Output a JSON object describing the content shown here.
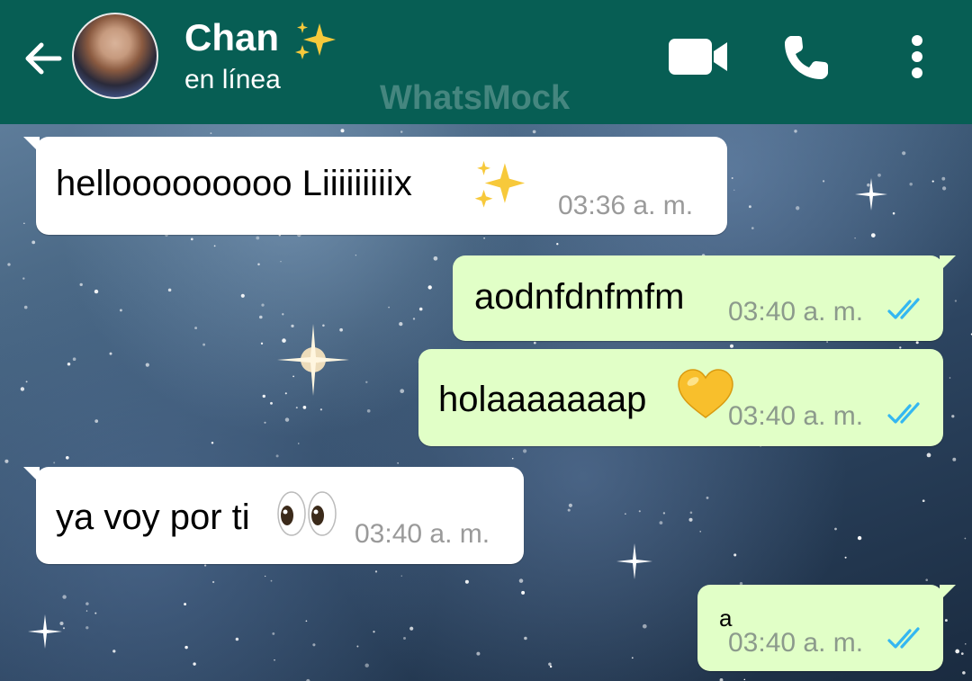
{
  "header": {
    "contact_name": "Chan",
    "status": "en línea",
    "watermark": "WhatsMock",
    "icons": [
      "back-arrow-icon",
      "sparkles-icon",
      "video-call-icon",
      "phone-icon",
      "more-vert-icon"
    ]
  },
  "messages": [
    {
      "direction": "in",
      "text": "hellooooooooo Liiiiiiiiix",
      "emoji": "sparkles",
      "time": "03:36 a. m."
    },
    {
      "direction": "out",
      "text": "aodnfdnfmfm",
      "time": "03:40 a. m.",
      "status": "read"
    },
    {
      "direction": "out",
      "text": "holaaaaaaap",
      "emoji": "yellow-heart",
      "time": "03:40 a. m.",
      "status": "read"
    },
    {
      "direction": "in",
      "text": "ya voy por ti",
      "emoji": "eyes",
      "time": "03:40 a. m."
    },
    {
      "direction": "out",
      "text": "a",
      "time": "03:40 a. m.",
      "status": "read"
    }
  ],
  "colors": {
    "header_bg": "#075e54",
    "outgoing_bubble": "#e1ffc7",
    "incoming_bubble": "#ffffff",
    "read_ticks": "#34b7f1"
  }
}
